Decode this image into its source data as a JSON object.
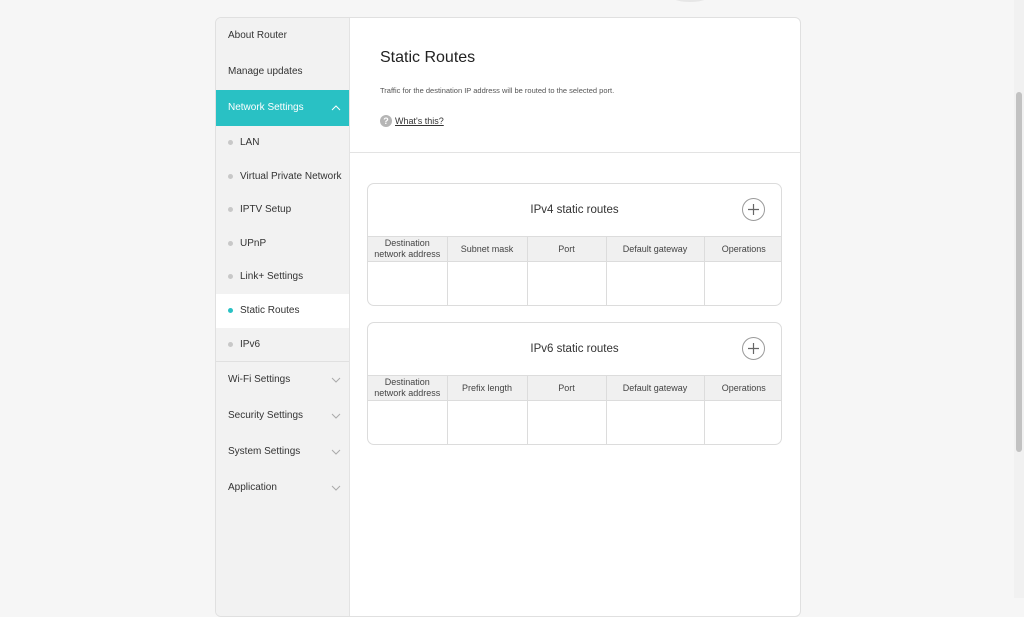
{
  "sidebar": {
    "about": "About Router",
    "updates": "Manage updates",
    "network": "Network Settings",
    "network_sub": [
      "LAN",
      "Virtual Private Network",
      "IPTV Setup",
      "UPnP",
      "Link+ Settings",
      "Static Routes",
      "IPv6"
    ],
    "selected_sub": "Static Routes",
    "groups": [
      "Wi-Fi Settings",
      "Security Settings",
      "System Settings",
      "Application"
    ]
  },
  "page": {
    "title": "Static Routes",
    "description": "Traffic for the destination IP address will be routed to the selected port.",
    "help_link": "What's this?",
    "help_icon": "?"
  },
  "ipv4": {
    "title": "IPv4 static routes",
    "columns": [
      "Destination network address",
      "Subnet mask",
      "Port",
      "Default gateway",
      "Operations"
    ]
  },
  "ipv6": {
    "title": "IPv6 static routes",
    "columns": [
      "Destination network address",
      "Prefix length",
      "Port",
      "Default gateway",
      "Operations"
    ]
  },
  "colors": {
    "accent": "#29c1c4"
  },
  "icons": {
    "add": "plus-circle-icon",
    "expand": "chevron-down-icon",
    "collapse": "chevron-up-icon",
    "help": "question-circle-icon"
  }
}
